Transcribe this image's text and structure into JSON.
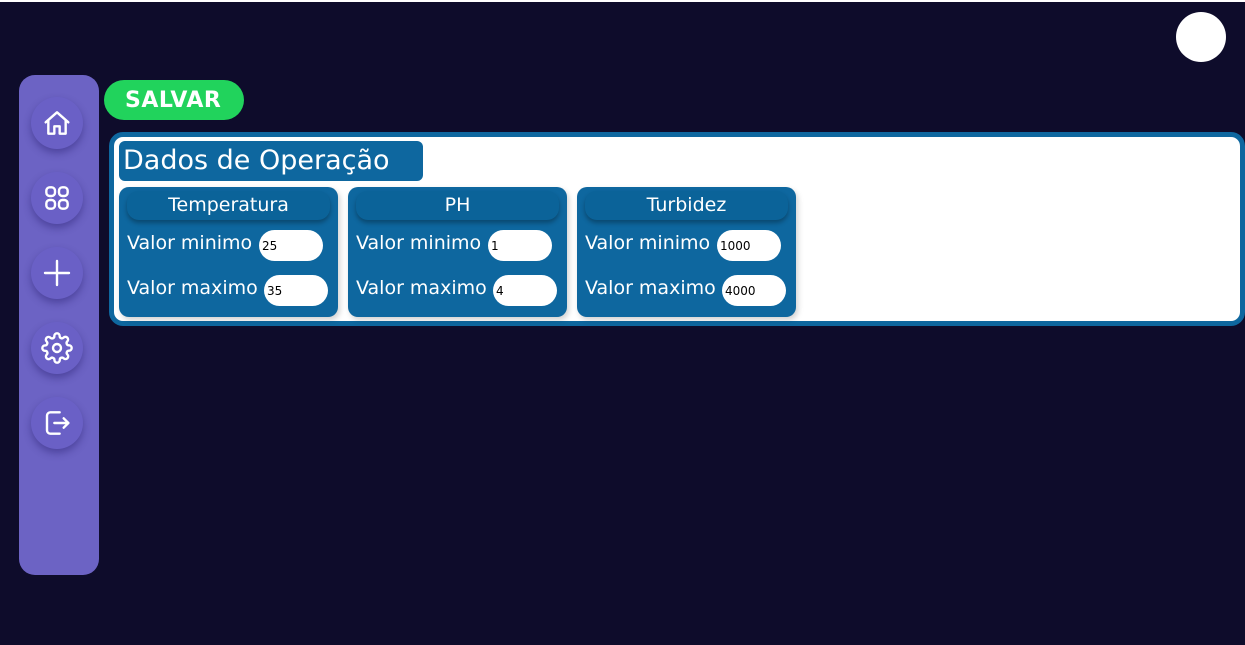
{
  "toolbar": {
    "save_label": "SALVAR"
  },
  "sidebar": {
    "items": [
      {
        "name": "home",
        "icon": "home-icon"
      },
      {
        "name": "dashboard",
        "icon": "grid-icon"
      },
      {
        "name": "add",
        "icon": "plus-icon"
      },
      {
        "name": "settings",
        "icon": "gear-icon"
      },
      {
        "name": "logout",
        "icon": "logout-icon"
      }
    ]
  },
  "panel": {
    "title": "Dados de Operação",
    "cards": [
      {
        "title": "Temperatura",
        "min_label": "Valor minimo",
        "min_value": "25",
        "max_label": "Valor maximo",
        "max_value": "35"
      },
      {
        "title": "PH",
        "min_label": "Valor minimo",
        "min_value": "1",
        "max_label": "Valor maximo",
        "max_value": "4"
      },
      {
        "title": "Turbidez",
        "min_label": "Valor minimo",
        "min_value": "1000",
        "max_label": "Valor maximo",
        "max_value": "4000"
      }
    ]
  },
  "colors": {
    "background": "#0e0c2b",
    "sidebar": "#6c63c4",
    "save": "#21d35c",
    "primary": "#0e679f"
  }
}
